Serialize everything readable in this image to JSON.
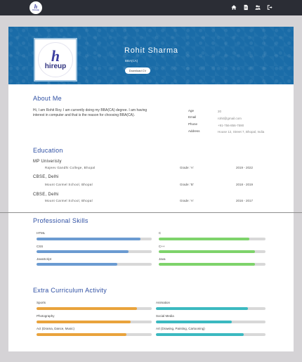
{
  "navbar": {
    "logo_mark": "h",
    "logo_text": "hireup",
    "icons": [
      "home-icon",
      "document-icon",
      "users-icon",
      "logout-icon"
    ]
  },
  "profile": {
    "avatar_mark": "h",
    "avatar_text": "hireup",
    "name": "Rohit Sharma",
    "course": "BBA(CA)",
    "download_label": "Download CV"
  },
  "about": {
    "title": "About Me",
    "text": "Hi, I am Rohit Roy. I am currently doing my BBA(CA) degree. I am having interest in computer and that is the reason for choosing BBA(CA).",
    "info": [
      {
        "label": "Age",
        "value": "20"
      },
      {
        "label": "Email",
        "value": "rohit@gmail.com"
      },
      {
        "label": "Phone",
        "value": "+91-756-856-7590"
      },
      {
        "label": "Address",
        "value": "House 12, Street 7, Bhopal, India"
      }
    ]
  },
  "education": {
    "title": "Education",
    "items": [
      {
        "school": "MP Univeristy",
        "place": "Rajeev Gandhi College, Bhopal",
        "grade": "Grade: 'A'",
        "years": "2019 - 2022"
      },
      {
        "school": "CBSE, Delhi",
        "place": "Mount Carmel School, Bhopal",
        "grade": "Grade: 'B'",
        "years": "2018 - 2019"
      },
      {
        "school": "CBSE, Delhi",
        "place": "Mount Carmel School, Bhopal",
        "grade": "Grade: 'A'",
        "years": "2016 - 2017"
      }
    ]
  },
  "skills": {
    "title": "Professional Skills",
    "left": [
      {
        "name": "HTML",
        "level": 0.9
      },
      {
        "name": "CSS",
        "level": 0.8
      },
      {
        "name": "JavaScript",
        "level": 0.7
      }
    ],
    "right": [
      {
        "name": "C",
        "level": 0.85
      },
      {
        "name": "C++",
        "level": 0.9
      },
      {
        "name": "Java",
        "level": 0.9
      }
    ]
  },
  "activities": {
    "title": "Extra Curriculum Activity",
    "left": [
      {
        "name": "Sports",
        "level": 0.87
      },
      {
        "name": "Photography",
        "level": 0.82
      },
      {
        "name": "Act (Drama, Dance, Music)",
        "level": 0.78
      }
    ],
    "right": [
      {
        "name": "Animation",
        "level": 0.84
      },
      {
        "name": "Social Media",
        "level": 0.69
      },
      {
        "name": "Art (Drawing, Painting, Cartooning)",
        "level": 0.8
      }
    ]
  },
  "colors": {
    "navbar": "#2b2d35",
    "hero": "#1a6ca8",
    "title": "#2e4fa3",
    "skill_left": "#6b9bd1",
    "skill_right": "#7ed36b",
    "activity_left": "#e9a33c",
    "activity_right": "#3bb9c0"
  }
}
